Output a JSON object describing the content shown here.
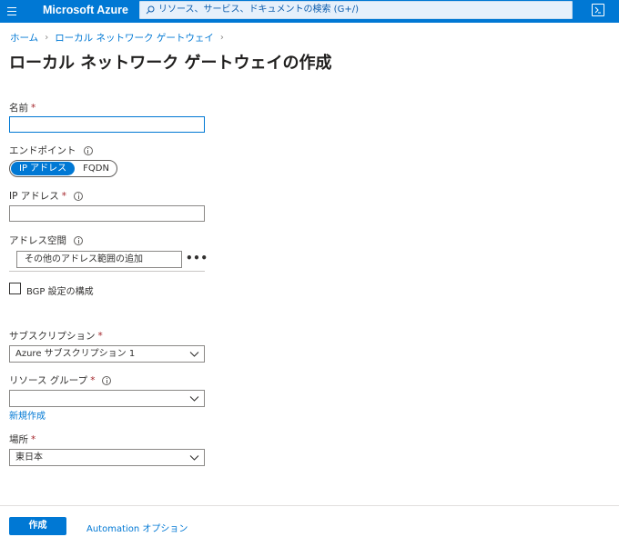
{
  "topbar": {
    "brand": "Microsoft Azure",
    "search_placeholder": "リソース、サービス、ドキュメントの検索 (G+/)",
    "accent": "#0078d4"
  },
  "breadcrumb": {
    "items": [
      "ホーム",
      "ローカル ネットワーク ゲートウェイ"
    ]
  },
  "page": {
    "title": "ローカル ネットワーク ゲートウェイの作成"
  },
  "form": {
    "name_label": "名前",
    "name_value": "",
    "endpoint_label": "エンドポイント",
    "endpoint_options": [
      "IP アドレス",
      "FQDN"
    ],
    "endpoint_selected": "IP アドレス",
    "ip_label": "IP アドレス",
    "ip_value": "",
    "address_space_label": "アドレス空間",
    "address_space_placeholder": "その他のアドレス範囲の追加",
    "bgp_label": "BGP 設定の構成",
    "bgp_checked": false,
    "subscription_label": "サブスクリプション",
    "subscription_value": "Azure サブスクリプション 1",
    "resource_group_label": "リソース グループ",
    "resource_group_value": "",
    "new_link": "新規作成",
    "location_label": "場所",
    "location_value": "東日本",
    "required_mark": "*"
  },
  "footer": {
    "create_label": "作成",
    "automation_label": "Automation オプション"
  }
}
